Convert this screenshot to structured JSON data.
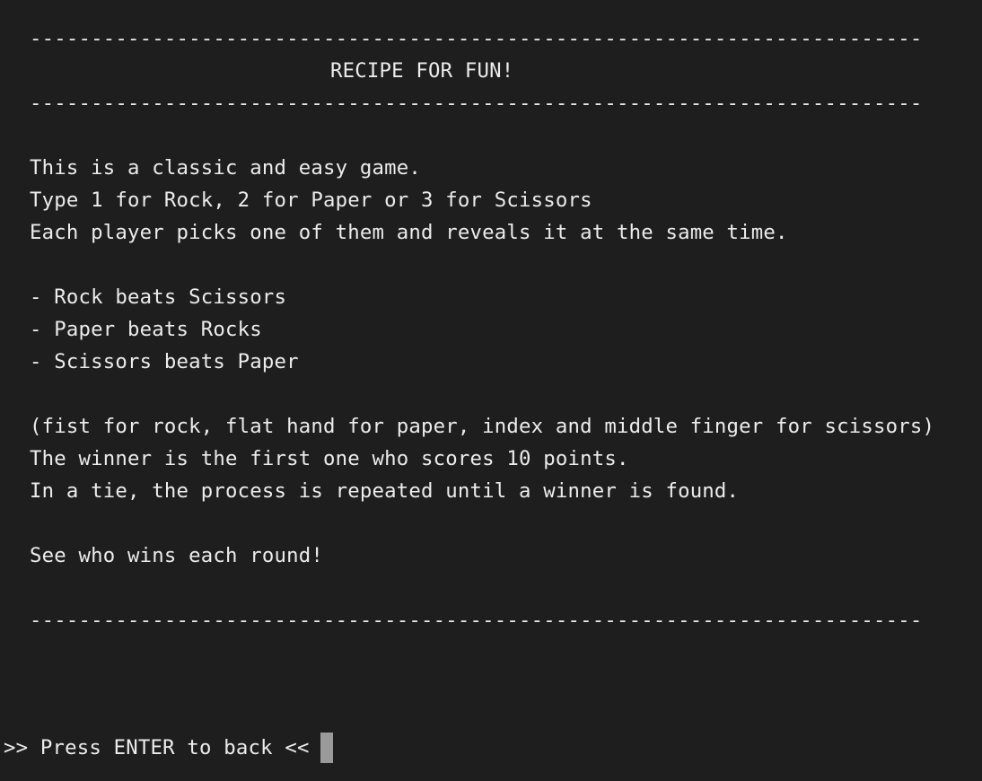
{
  "rule": "-------------------------------------------------------------------------",
  "title": "RECIPE FOR FUN!",
  "intro": [
    "This is a classic and easy game.",
    "Type 1 for Rock, 2 for Paper or 3 for Scissors",
    "Each player picks one of them and reveals it at the same time."
  ],
  "rules": [
    "- Rock beats Scissors",
    "- Paper beats Rocks",
    "- Scissors beats Paper"
  ],
  "details": [
    "(fist for rock, flat hand for paper, index and middle finger for scissors)",
    "The winner is the first one who scores 10 points.",
    "In a tie, the process is repeated until a winner is found."
  ],
  "closing": "See who wins each round!",
  "prompt": ">> Press ENTER to back <<"
}
